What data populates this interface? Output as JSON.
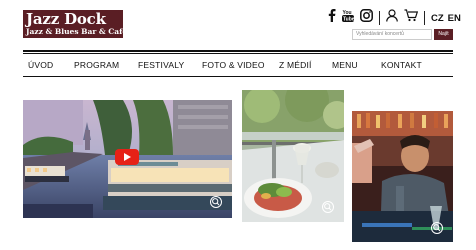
{
  "header": {
    "logo_title": "Jazz Dock",
    "logo_subtitle": "Jazz & Blues  Bar & Café",
    "icons": [
      "facebook-icon",
      "youtube-icon",
      "instagram-icon",
      "user-icon",
      "cart-icon"
    ],
    "languages": [
      "CZ",
      "EN"
    ],
    "search_placeholder": "Vyhledávání koncertů",
    "search_button": "Najít"
  },
  "nav": {
    "items": [
      "ÚVOD",
      "PROGRAM",
      "FESTIVALY",
      "FOTO & VIDEO",
      "Z MÉDIÍ",
      "MENU",
      "KONTAKT"
    ]
  },
  "colors": {
    "brand": "#5a1e24",
    "youtube": "#e62117"
  },
  "gallery": {
    "tiles": [
      "river-video-tile",
      "food-terrace-tile",
      "bartender-tile"
    ]
  }
}
